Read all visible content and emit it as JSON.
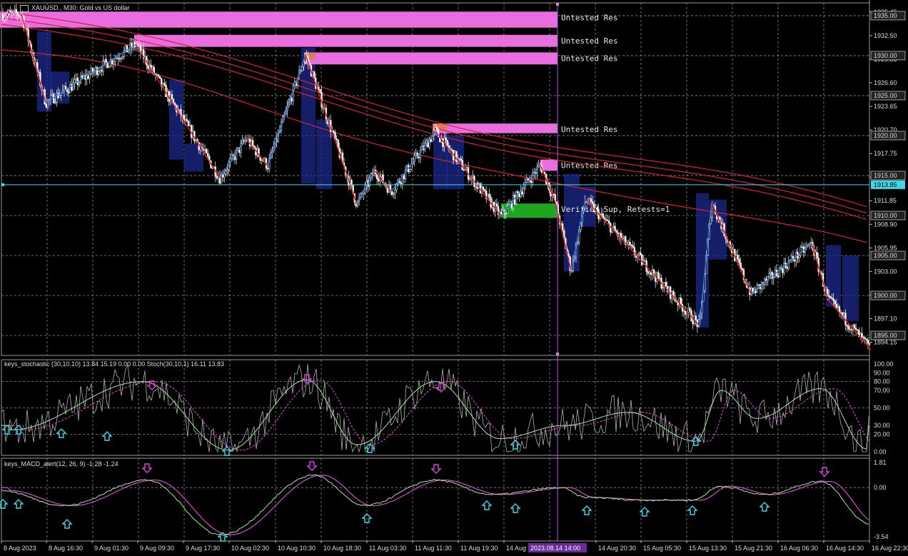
{
  "window": {
    "symbol_title": "XAUUSD., M30: Gold vs US dollar",
    "icon": "chart-window-icon"
  },
  "colors": {
    "background": "#000000",
    "grid": "#8c8c8c",
    "candle": "#ffffff",
    "resistance_zone": "#e86ee0",
    "support_zone": "#1fa51f",
    "zigzag_up": "#2f7fe8",
    "zigzag_down": "#e01818",
    "ma": "#d81e3c",
    "stoch_main": "#a8e8a0",
    "stoch_signal": "#e64ee0",
    "stoch_raw": "#b0b0b0",
    "macd_main": "#a8e8a0",
    "macd_signal": "#e64ee0",
    "arrow_up": "#40d8e8",
    "arrow_down": "#e040e0",
    "current_price": "#40d8e8",
    "box_blue": "#1c2a8c"
  },
  "chart_data": [
    {
      "type": "candlestick",
      "panel": "price",
      "ylim": [
        1892.5,
        1936.6
      ],
      "y_ticks": [
        "1935.45",
        "1932.50",
        "1929.55",
        "1926.60",
        "1923.65",
        "1920.70",
        "1917.75",
        "1914.80",
        "1911.85",
        "1908.90",
        "1905.95",
        "1903.00",
        "1900.05",
        "1897.10",
        "1894.15"
      ],
      "price_levels": [
        "1935.00",
        "1930.00",
        "1925.00",
        "1920.00",
        "1915.00",
        "1910.00",
        "1905.00",
        "1900.00",
        "1895.00"
      ],
      "current_price": "1913.85",
      "x_labels": [
        "8 Aug 2023",
        "8 Aug 16:30",
        "9 Aug 01:30",
        "9 Aug 09:30",
        "9 Aug 17:30",
        "10 Aug 02:30",
        "10 Aug 10:30",
        "10 Aug 18:30",
        "11 Aug 03:30",
        "11 Aug 11:30",
        "11 Aug 19:30",
        "14 Aug 0",
        "2023.08.14 14:00",
        "14 Aug 20:30",
        "15 Aug 05:30",
        "15 Aug 13:30",
        "15 Aug 21:30",
        "16 Aug 06:30",
        "16 Aug 14:30",
        "16 Aug 22:30"
      ],
      "cursor_label": "2023.08.14 14:00",
      "zones": [
        {
          "label": "Untested Res",
          "kind": "res",
          "top": 1935.5,
          "bottom": 1933.5
        },
        {
          "label": "Untested Res",
          "kind": "res",
          "top": 1932.6,
          "bottom": 1931.1
        },
        {
          "label": "Untested Res",
          "kind": "res",
          "top": 1930.4,
          "bottom": 1928.9
        },
        {
          "label": "Untested Res",
          "kind": "res",
          "top": 1921.5,
          "bottom": 1920.3
        },
        {
          "label": "Untested Res",
          "kind": "res",
          "top": 1917.0,
          "bottom": 1915.6
        },
        {
          "label": "Verified Sup, Retests=1",
          "kind": "sup",
          "top": 1911.5,
          "bottom": 1909.7
        }
      ],
      "zigzag": [
        1935.2,
        1924.1,
        1931.4,
        1914.7,
        1919.6,
        1916.2,
        1930.1,
        1911.4,
        1915.6,
        1913.0,
        1920.5,
        1909.9,
        1916.3,
        1911.6,
        1903.1,
        1912.0,
        1904.7,
        1896.2,
        1911.6,
        1900.2,
        1906.5,
        1899.5,
        1893.2
      ]
    },
    {
      "type": "line",
      "panel": "stochastic",
      "title": "keys_stochastic (30,10,10) 13.84 15.19 0.00 0.00 Stoch(30,10,1) 16.11 13.83",
      "ylim": [
        0,
        100
      ],
      "y_ticks": [
        "100.00",
        "90.00",
        "80.00",
        "70.00",
        "50.00",
        "30.00",
        "20.00",
        "0.00"
      ]
    },
    {
      "type": "line",
      "panel": "macd",
      "title": "keys_MACD_alert(12, 26, 9) -1.28 -1.24",
      "ylim": [
        -3.54,
        1.81
      ],
      "y_ticks": [
        "1.81",
        "0.00",
        "-3.54"
      ]
    }
  ]
}
